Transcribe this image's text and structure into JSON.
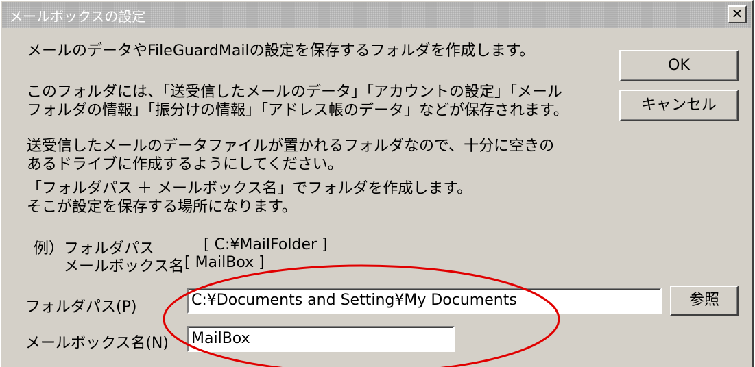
{
  "window": {
    "title": "メールボックスの設定",
    "close_label": "x"
  },
  "description": {
    "line1": "メールのデータやFileGuardMailの設定を保存するフォルダを作成します。",
    "line2a": "このフォルダには、「送受信したメールのデータ」「アカウントの設定」「メール",
    "line2b": "フォルダの情報」「振分けの情報」「アドレス帳のデータ」などが保存されます。",
    "line3a": "送受信したメールのデータファイルが置かれるフォルダなので、十分に空きの",
    "line3b": "あるドライブに作成するようにしてください。",
    "line4a": "「フォルダパス ＋ メールボックス名」でフォルダを作成します。",
    "line4b": "そこが設定を保存する場所になります。"
  },
  "example": {
    "prefix": "例）",
    "folder_label": "フォルダパス",
    "folder_value": "[ C:¥MailFolder ]",
    "mailbox_label": "メールボックス名",
    "mailbox_value": "[ MailBox ]"
  },
  "buttons": {
    "ok": "OK",
    "cancel": "キャンセル",
    "browse": "参照"
  },
  "fields": {
    "folder_path_label": "フォルダパス(P)",
    "folder_path_value": "C:¥Documents and Setting¥My Documents",
    "mailbox_name_label": "メールボックス名(N)",
    "mailbox_name_value": "MailBox"
  },
  "colors": {
    "dialog_bg": "#d4d0c8",
    "annotation_ellipse": "#e00000"
  }
}
